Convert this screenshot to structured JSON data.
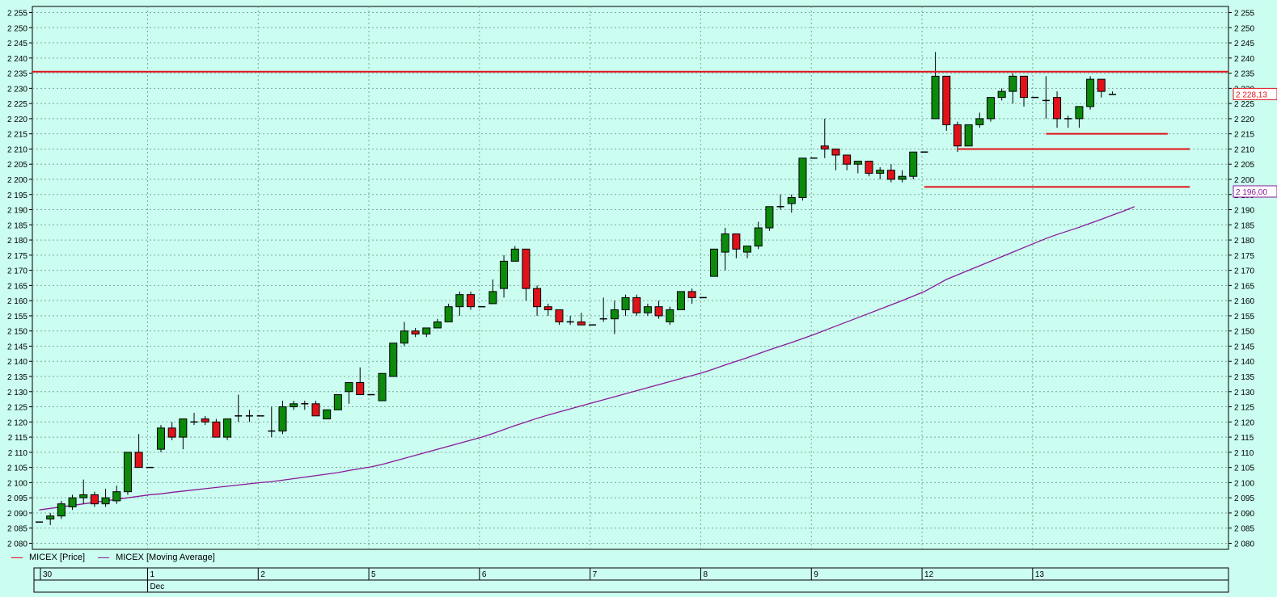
{
  "colors": {
    "background": "#cbfdf0",
    "grid": "#7da89a",
    "up_candle": "#0c8a0c",
    "down_candle": "#e0121a",
    "price_line": "#e0121a",
    "moving_average": "#8a1a9a",
    "last_price_box": "#e0121a",
    "ma_box": "#8a1a9a"
  },
  "chart_data": {
    "type": "candlestick",
    "instrument": "MICEX",
    "ylim": [
      2078,
      2257
    ],
    "yticks": [
      2080,
      2085,
      2090,
      2095,
      2100,
      2105,
      2110,
      2115,
      2120,
      2125,
      2130,
      2135,
      2140,
      2145,
      2150,
      2155,
      2160,
      2165,
      2170,
      2175,
      2180,
      2185,
      2190,
      2195,
      2200,
      2205,
      2210,
      2215,
      2220,
      2225,
      2230,
      2235,
      2240,
      2245,
      2250,
      2255
    ],
    "ytick_labels": [
      "2 080",
      "2 085",
      "2 090",
      "2 095",
      "2 100",
      "2 105",
      "2 110",
      "2 115",
      "2 120",
      "2 125",
      "2 130",
      "2 135",
      "2 140",
      "2 145",
      "2 150",
      "2 155",
      "2 160",
      "2 165",
      "2 170",
      "2 175",
      "2 180",
      "2 185",
      "2 190",
      "2 195",
      "2 200",
      "2 205",
      "2 210",
      "2 215",
      "2 220",
      "2 225",
      "2 230",
      "2 235",
      "2 240",
      "2 245",
      "2 250",
      "2 255"
    ],
    "day_labels": [
      {
        "index": 0,
        "label": "30"
      },
      {
        "index": 10,
        "label": "1"
      },
      {
        "index": 20,
        "label": "2"
      },
      {
        "index": 30,
        "label": "5"
      },
      {
        "index": 40,
        "label": "6"
      },
      {
        "index": 50,
        "label": "7"
      },
      {
        "index": 60,
        "label": "8"
      },
      {
        "index": 70,
        "label": "9"
      },
      {
        "index": 80,
        "label": "12"
      },
      {
        "index": 90,
        "label": "13"
      }
    ],
    "month_label": {
      "index": 10,
      "label": "Dec"
    },
    "candles": [
      {
        "o": 2087,
        "h": 2087,
        "l": 2087,
        "c": 2087
      },
      {
        "o": 2088,
        "h": 2090,
        "l": 2086,
        "c": 2089
      },
      {
        "o": 2089,
        "h": 2094,
        "l": 2088,
        "c": 2093
      },
      {
        "o": 2092,
        "h": 2096,
        "l": 2091,
        "c": 2095
      },
      {
        "o": 2095,
        "h": 2101,
        "l": 2093,
        "c": 2096
      },
      {
        "o": 2096,
        "h": 2097,
        "l": 2092,
        "c": 2093
      },
      {
        "o": 2093,
        "h": 2098,
        "l": 2092,
        "c": 2095
      },
      {
        "o": 2094,
        "h": 2099,
        "l": 2093,
        "c": 2097
      },
      {
        "o": 2097,
        "h": 2110,
        "l": 2096,
        "c": 2110
      },
      {
        "o": 2110,
        "h": 2116,
        "l": 2105,
        "c": 2105
      },
      {
        "o": 2105,
        "h": 2105,
        "l": 2105,
        "c": 2105
      },
      {
        "o": 2111,
        "h": 2119,
        "l": 2110,
        "c": 2118
      },
      {
        "o": 2118,
        "h": 2120,
        "l": 2114,
        "c": 2115
      },
      {
        "o": 2115,
        "h": 2121,
        "l": 2111,
        "c": 2121
      },
      {
        "o": 2120,
        "h": 2123,
        "l": 2119,
        "c": 2120
      },
      {
        "o": 2121,
        "h": 2122,
        "l": 2119,
        "c": 2120
      },
      {
        "o": 2120,
        "h": 2121,
        "l": 2115,
        "c": 2115
      },
      {
        "o": 2115,
        "h": 2121,
        "l": 2114,
        "c": 2121
      },
      {
        "o": 2122,
        "h": 2129,
        "l": 2120,
        "c": 2122
      },
      {
        "o": 2122,
        "h": 2124,
        "l": 2120,
        "c": 2122
      },
      {
        "o": 2122,
        "h": 2122,
        "l": 2122,
        "c": 2122
      },
      {
        "o": 2117,
        "h": 2125,
        "l": 2115,
        "c": 2117
      },
      {
        "o": 2117,
        "h": 2127,
        "l": 2116,
        "c": 2125
      },
      {
        "o": 2125,
        "h": 2127,
        "l": 2124,
        "c": 2126
      },
      {
        "o": 2126,
        "h": 2127,
        "l": 2124,
        "c": 2126
      },
      {
        "o": 2126,
        "h": 2127,
        "l": 2122,
        "c": 2122
      },
      {
        "o": 2121,
        "h": 2124,
        "l": 2121,
        "c": 2124
      },
      {
        "o": 2124,
        "h": 2129,
        "l": 2124,
        "c": 2129
      },
      {
        "o": 2130,
        "h": 2133,
        "l": 2126,
        "c": 2133
      },
      {
        "o": 2133,
        "h": 2138,
        "l": 2129,
        "c": 2129
      },
      {
        "o": 2129,
        "h": 2129,
        "l": 2129,
        "c": 2129
      },
      {
        "o": 2127,
        "h": 2136,
        "l": 2127,
        "c": 2136
      },
      {
        "o": 2135,
        "h": 2146,
        "l": 2135,
        "c": 2146
      },
      {
        "o": 2146,
        "h": 2153,
        "l": 2145,
        "c": 2150
      },
      {
        "o": 2150,
        "h": 2151,
        "l": 2148,
        "c": 2149
      },
      {
        "o": 2149,
        "h": 2151,
        "l": 2148,
        "c": 2151
      },
      {
        "o": 2151,
        "h": 2154,
        "l": 2151,
        "c": 2153
      },
      {
        "o": 2153,
        "h": 2159,
        "l": 2153,
        "c": 2158
      },
      {
        "o": 2158,
        "h": 2163,
        "l": 2155,
        "c": 2162
      },
      {
        "o": 2162,
        "h": 2163,
        "l": 2157,
        "c": 2158
      },
      {
        "o": 2158,
        "h": 2158,
        "l": 2158,
        "c": 2158
      },
      {
        "o": 2159,
        "h": 2167,
        "l": 2159,
        "c": 2163
      },
      {
        "o": 2164,
        "h": 2175,
        "l": 2161,
        "c": 2173
      },
      {
        "o": 2173,
        "h": 2178,
        "l": 2173,
        "c": 2177
      },
      {
        "o": 2177,
        "h": 2177,
        "l": 2160,
        "c": 2164
      },
      {
        "o": 2164,
        "h": 2165,
        "l": 2155,
        "c": 2158
      },
      {
        "o": 2158,
        "h": 2159,
        "l": 2155,
        "c": 2157
      },
      {
        "o": 2157,
        "h": 2157,
        "l": 2152,
        "c": 2153
      },
      {
        "o": 2153,
        "h": 2155,
        "l": 2152,
        "c": 2153
      },
      {
        "o": 2153,
        "h": 2156,
        "l": 2152,
        "c": 2152
      },
      {
        "o": 2152,
        "h": 2152,
        "l": 2152,
        "c": 2152
      },
      {
        "o": 2154,
        "h": 2161,
        "l": 2153,
        "c": 2154
      },
      {
        "o": 2154,
        "h": 2160,
        "l": 2149,
        "c": 2157
      },
      {
        "o": 2157,
        "h": 2162,
        "l": 2155,
        "c": 2161
      },
      {
        "o": 2161,
        "h": 2162,
        "l": 2155,
        "c": 2156
      },
      {
        "o": 2156,
        "h": 2159,
        "l": 2155,
        "c": 2158
      },
      {
        "o": 2158,
        "h": 2160,
        "l": 2154,
        "c": 2155
      },
      {
        "o": 2153,
        "h": 2158,
        "l": 2152,
        "c": 2157
      },
      {
        "o": 2157,
        "h": 2163,
        "l": 2157,
        "c": 2163
      },
      {
        "o": 2163,
        "h": 2164,
        "l": 2159,
        "c": 2161
      },
      {
        "o": 2161,
        "h": 2161,
        "l": 2161,
        "c": 2161
      },
      {
        "o": 2168,
        "h": 2177,
        "l": 2168,
        "c": 2177
      },
      {
        "o": 2176,
        "h": 2184,
        "l": 2170,
        "c": 2182
      },
      {
        "o": 2182,
        "h": 2182,
        "l": 2174,
        "c": 2177
      },
      {
        "o": 2176,
        "h": 2178,
        "l": 2174,
        "c": 2178
      },
      {
        "o": 2178,
        "h": 2186,
        "l": 2177,
        "c": 2184
      },
      {
        "o": 2184,
        "h": 2191,
        "l": 2183,
        "c": 2191
      },
      {
        "o": 2191,
        "h": 2195,
        "l": 2190,
        "c": 2191
      },
      {
        "o": 2192,
        "h": 2195,
        "l": 2189,
        "c": 2194
      },
      {
        "o": 2194,
        "h": 2207,
        "l": 2193,
        "c": 2207
      },
      {
        "o": 2207,
        "h": 2207,
        "l": 2207,
        "c": 2207
      },
      {
        "o": 2211,
        "h": 2220,
        "l": 2207,
        "c": 2210
      },
      {
        "o": 2210,
        "h": 2210,
        "l": 2203,
        "c": 2208
      },
      {
        "o": 2208,
        "h": 2208,
        "l": 2203,
        "c": 2205
      },
      {
        "o": 2205,
        "h": 2206,
        "l": 2202,
        "c": 2206
      },
      {
        "o": 2206,
        "h": 2206,
        "l": 2201,
        "c": 2202
      },
      {
        "o": 2202,
        "h": 2204,
        "l": 2200,
        "c": 2203
      },
      {
        "o": 2203,
        "h": 2205,
        "l": 2199,
        "c": 2200
      },
      {
        "o": 2200,
        "h": 2203,
        "l": 2199,
        "c": 2201
      },
      {
        "o": 2201,
        "h": 2209,
        "l": 2200,
        "c": 2209
      },
      {
        "o": 2209,
        "h": 2209,
        "l": 2209,
        "c": 2209
      },
      {
        "o": 2220,
        "h": 2242,
        "l": 2220,
        "c": 2234
      },
      {
        "o": 2234,
        "h": 2234,
        "l": 2216,
        "c": 2218
      },
      {
        "o": 2218,
        "h": 2219,
        "l": 2209,
        "c": 2211
      },
      {
        "o": 2211,
        "h": 2217,
        "l": 2211,
        "c": 2218
      },
      {
        "o": 2218,
        "h": 2222,
        "l": 2217,
        "c": 2220
      },
      {
        "o": 2220,
        "h": 2227,
        "l": 2219,
        "c": 2227
      },
      {
        "o": 2227,
        "h": 2230,
        "l": 2226,
        "c": 2229
      },
      {
        "o": 2229,
        "h": 2235,
        "l": 2225,
        "c": 2234
      },
      {
        "o": 2234,
        "h": 2234,
        "l": 2224,
        "c": 2227
      },
      {
        "o": 2227,
        "h": 2227,
        "l": 2227,
        "c": 2227
      },
      {
        "o": 2226,
        "h": 2234,
        "l": 2220,
        "c": 2226
      },
      {
        "o": 2227,
        "h": 2229,
        "l": 2217,
        "c": 2220
      },
      {
        "o": 2220,
        "h": 2221,
        "l": 2217,
        "c": 2220
      },
      {
        "o": 2220,
        "h": 2224,
        "l": 2217,
        "c": 2224
      },
      {
        "o": 2224,
        "h": 2234,
        "l": 2223,
        "c": 2233
      },
      {
        "o": 2233,
        "h": 2233,
        "l": 2227,
        "c": 2229
      },
      {
        "o": 2228,
        "h": 2229,
        "l": 2228,
        "c": 2228
      }
    ],
    "moving_average": [
      2091,
      2091.5,
      2092,
      2092.5,
      2093,
      2093.5,
      2094,
      2094.5,
      2095,
      2095.5,
      2096,
      2096.3,
      2096.8,
      2097.2,
      2097.6,
      2098,
      2098.4,
      2098.8,
      2099.2,
      2099.6,
      2100,
      2100.3,
      2100.8,
      2101.3,
      2101.8,
      2102.3,
      2102.8,
      2103.3,
      2104,
      2104.6,
      2105.2,
      2106,
      2107,
      2108,
      2109,
      2110,
      2111,
      2112,
      2113,
      2114,
      2115,
      2116.2,
      2117.5,
      2118.8,
      2120,
      2121.2,
      2122.3,
      2123.3,
      2124.3,
      2125.3,
      2126.3,
      2127.3,
      2128.3,
      2129.3,
      2130.3,
      2131.3,
      2132.3,
      2133.3,
      2134.3,
      2135.3,
      2136.3,
      2137.5,
      2138.8,
      2140,
      2141.2,
      2142.5,
      2143.8,
      2145,
      2146.2,
      2147.5,
      2148.8,
      2150.2,
      2151.6,
      2153,
      2154.4,
      2155.8,
      2157.2,
      2158.6,
      2160,
      2161.5,
      2163,
      2165,
      2167,
      2168.5,
      2170,
      2171.5,
      2173,
      2174.5,
      2176,
      2177.5,
      2179,
      2180.5,
      2181.8,
      2183,
      2184.2,
      2185.5,
      2186.8,
      2188.2,
      2189.5,
      2191
    ],
    "horizontal_lines": [
      {
        "value": 2235.5,
        "from_index": -2,
        "to_index": 112
      },
      {
        "value": 2215,
        "from_index": 91,
        "to_index": 102
      },
      {
        "value": 2210,
        "from_index": 83,
        "to_index": 104
      },
      {
        "value": 2197.5,
        "from_index": 80,
        "to_index": 104
      }
    ],
    "last_price_label": "2 228,13",
    "ma_label": "2 196,00",
    "legend": [
      {
        "name": "MICEX [Price]",
        "color": "#e0121a"
      },
      {
        "name": "MICEX [Moving Average]",
        "color": "#8a1a9a"
      }
    ]
  }
}
